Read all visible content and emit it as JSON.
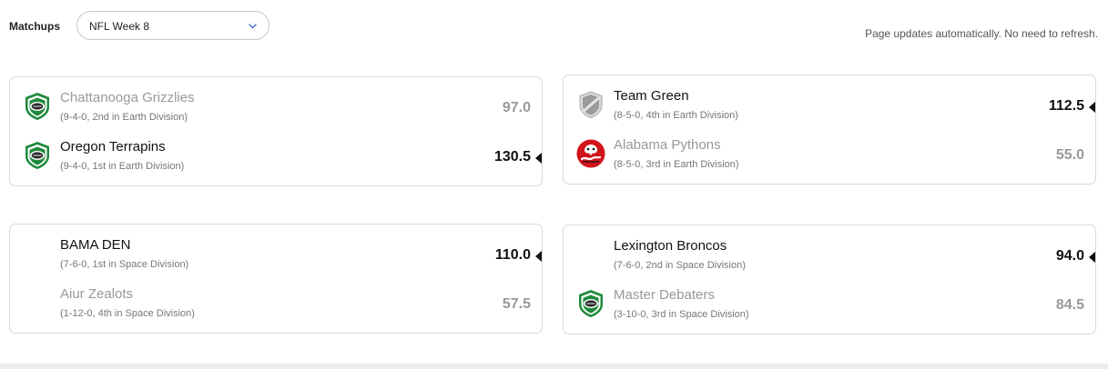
{
  "header": {
    "matchups_label": "Matchups",
    "week_selected": "NFL Week 8",
    "refresh_note": "Page updates automatically. No need to refresh."
  },
  "matchups": [
    {
      "top": {
        "name": "Chattanooga Grizzlies",
        "record": "(9-4-0, 2nd in Earth Division)",
        "score": "97.0",
        "icon": "football-shield-icon",
        "winner": false
      },
      "bottom": {
        "name": "Oregon Terrapins",
        "record": "(9-4-0, 1st in Earth Division)",
        "score": "130.5",
        "icon": "football-shield-icon",
        "winner": true
      }
    },
    {
      "top": {
        "name": "Team Green",
        "record": "(8-5-0, 4th in Earth Division)",
        "score": "112.5",
        "icon": "grey-shield-icon",
        "winner": true
      },
      "bottom": {
        "name": "Alabama Pythons",
        "record": "(8-5-0, 3rd in Earth Division)",
        "score": "55.0",
        "icon": "red-python-logo-icon",
        "winner": false
      }
    },
    {
      "top": {
        "name": "BAMA DEN",
        "record": "(7-6-0, 1st in Space Division)",
        "score": "110.0",
        "icon": "",
        "winner": true
      },
      "bottom": {
        "name": "Aiur Zealots",
        "record": "(1-12-0, 4th in Space Division)",
        "score": "57.5",
        "icon": "",
        "winner": false
      }
    },
    {
      "top": {
        "name": "Lexington Broncos",
        "record": "(7-6-0, 2nd in Space Division)",
        "score": "94.0",
        "icon": "",
        "winner": true
      },
      "bottom": {
        "name": "Master Debaters",
        "record": "(3-10-0, 3rd in Space Division)",
        "score": "84.5",
        "icon": "football-shield-icon",
        "winner": false
      }
    }
  ],
  "colors": {
    "winner_text": "#111111",
    "loser_text": "#999999",
    "shield_green": "#1e8a3c",
    "python_red": "#d0141b"
  }
}
